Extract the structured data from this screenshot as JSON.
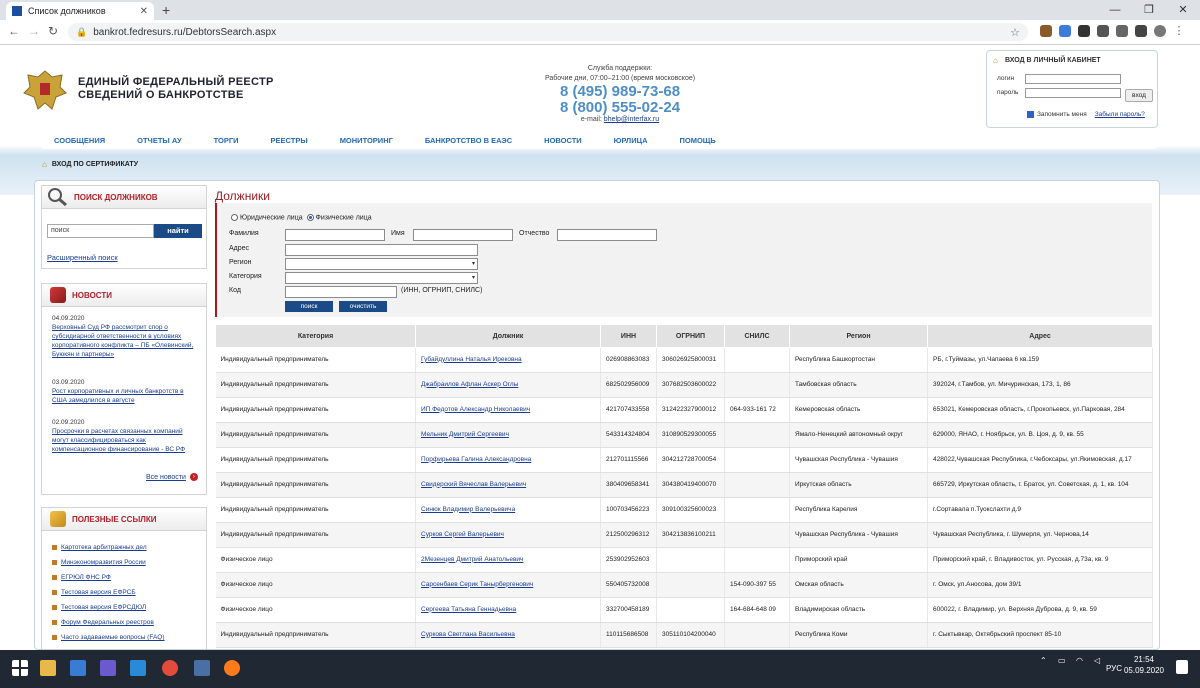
{
  "browser": {
    "tab_title": "Список должников",
    "new_tab": "+",
    "url": "bankrot.fedresurs.ru/DebtorsSearch.aspx",
    "window_controls": [
      "—",
      "❐",
      "✕"
    ]
  },
  "site": {
    "title_line1": "ЕДИНЫЙ ФЕДЕРАЛЬНЫЙ РЕЕСТР",
    "title_line2": "СВЕДЕНИЙ О БАНКРОТСТВЕ",
    "support_label": "Служба поддержки:",
    "support_hours": "Рабочие дни, 07:00–21:00 (время московское)",
    "phone1": "8 (495) 989-73-68",
    "phone2": "8 (800) 555-02-24",
    "email_label": "e-mail:",
    "email": "bhelp@interfax.ru"
  },
  "login": {
    "title": "ВХОД В ЛИЧНЫЙ КАБИНЕТ",
    "login_label": "логин",
    "password_label": "пароль",
    "button": "вход",
    "remember": "Запомнить меня",
    "forgot": "Забыли пароль?"
  },
  "menu": [
    "СООБЩЕНИЯ",
    "ОТЧЕТЫ АУ",
    "ТОРГИ",
    "РЕЕСТРЫ",
    "МОНИТОРИНГ",
    "БАНКРОТСТВО В ЕАЭС",
    "НОВОСТИ",
    "ЮРЛИЦА",
    "ПОМОЩЬ"
  ],
  "cert_login": "ВХОД ПО СЕРТИФИКАТУ",
  "sidebar": {
    "search_title": "ПОИСК ДОЛЖНИКОВ",
    "search_placeholder": "поиск",
    "search_button": "найти",
    "advanced": "Расширенный поиск",
    "news_title": "НОВОСТИ",
    "news": [
      {
        "date": "04.09.2020",
        "text": "Верховный Суд РФ рассмотрит спор о субсидиарной ответственности в условиях корпоративного конфликта – ПБ «Олевинский, Буюкян и партнеры»"
      },
      {
        "date": "03.09.2020",
        "text": "Рост корпоративных и личных банкротств в США замедлился в августе"
      },
      {
        "date": "02.09.2020",
        "text": "Просрочки в расчетах связанных компаний могут классифицироваться как компенсационное финансирование - ВС РФ"
      }
    ],
    "all_news": "Все новости",
    "links_title": "ПОЛЕЗНЫЕ ССЫЛКИ",
    "links": [
      "Картотека арбитражных дел",
      "Минэкономразвития России",
      "ЕГРЮЛ ФНС РФ",
      "Тестовая версия ЕФРСБ",
      "Тестовая версия ЕФРСДЮЛ",
      "Форум Федеральных реестров",
      "Часто задаваемые вопросы (FAQ)"
    ]
  },
  "content": {
    "title": "Должники",
    "radio_legal": "Юридические лица",
    "radio_person": "Физические лица",
    "surname": "Фамилия",
    "name": "Имя",
    "patronymic": "Отчество",
    "address": "Адрес",
    "region": "Регион",
    "category": "Категория",
    "code": "Код",
    "code_hint": "(ИНН, ОГРНИП, СНИЛС)",
    "search_btn": "поиск",
    "clear_btn": "очистить"
  },
  "table": {
    "headers": [
      "Категория",
      "Должник",
      "ИНН",
      "ОГРНИП",
      "СНИЛС",
      "Регион",
      "Адрес"
    ],
    "rows": [
      [
        "Индивидуальный предприниматель",
        "Губайдуллина Наталья Ирековна",
        "026908863083",
        "306026925800031",
        "",
        "Республика Башкортостан",
        "РБ, г.Туймазы, ул.Чапаева 6 кв.159"
      ],
      [
        "Индивидуальный предприниматель",
        "Джабраилов Афлан Аскер Оглы",
        "682502956009",
        "307682503600022",
        "",
        "Тамбовская область",
        "392024, г.Тамбов, ул. Мичуринская, 173, 1, 86"
      ],
      [
        "Индивидуальный предприниматель",
        "ИП Федотов Александр Николаевич",
        "421707433558",
        "312422327900012",
        "064-933-161 72",
        "Кемеровская область",
        "653021, Кемеровская область, г.Прокопьевск, ул.Парковая, 284"
      ],
      [
        "Индивидуальный предприниматель",
        "Мельник Дмитрий Сергеевич",
        "543314324804",
        "310890529300055",
        "",
        "Ямало-Ненецкий автономный округ",
        "629000, ЯНАО, г. Ноябрьск, ул. В. Цоя, д. 9, кв. 55"
      ],
      [
        "Индивидуальный предприниматель",
        "Порфирьева Галина Александровна",
        "212701115566",
        "304212728700054",
        "",
        "Чувашская Республика - Чувашия",
        "428022,Чувашская Республика, г.Чебоксары, ул.Якимовская, д.17"
      ],
      [
        "Индивидуальный предприниматель",
        "Свидерский Вячеслав Валерьевич",
        "380409658341",
        "304380419400070",
        "",
        "Иркутская область",
        "665729, Иркутская область, г. Братск, ул. Советская, д. 1, кв. 104"
      ],
      [
        "Индивидуальный предприниматель",
        "Синюк Владимир Валерьевича",
        "100703456223",
        "309100325600023",
        "",
        "Республика Карелия",
        "г.Сортавала п.Туокслахти д.9"
      ],
      [
        "Индивидуальный предприниматель",
        "Сурков Сергей Валерьевич",
        "212500296312",
        "304213836100211",
        "",
        "Чувашская Республика - Чувашия",
        "Чувашская Республика, г. Шумерля, ул. Чернова,14"
      ],
      [
        "Физическое лицо",
        "2Мезенцев Дмитрий Анатольевич",
        "253902952603",
        "",
        "",
        "Приморский край",
        "Приморский край, г. Владивосток, ул. Русская, д.73а, кв. 9"
      ],
      [
        "Физическое лицо",
        "Сарсенбаев Серик Танырбергенович",
        "550405732008",
        "",
        "154-090-397 55",
        "Омская область",
        "г. Омск, ул.Аносова, дом 39/1"
      ],
      [
        "Физическое лицо",
        "Сергеева Татьяна Геннадьевна",
        "332700458189",
        "",
        "164-684-648 09",
        "Владимирская область",
        "600022, г. Владимир, ул. Верхняя Дуброва, д. 9, кв. 59"
      ],
      [
        "Индивидуальный предприниматель",
        "Суркова Светлана Васильевна",
        "110115686508",
        "305110104200040",
        "",
        "Республика Коми",
        "г. Сыктывкар, Октябрьский проспект 85-10"
      ]
    ]
  },
  "taskbar": {
    "lang": "РУС",
    "time": "21:54",
    "date": "05.09.2020"
  },
  "colors": {
    "accent_red": "#9a1c25",
    "nav_blue": "#2469b0",
    "button_blue": "#1b4b86",
    "phone_blue": "#4d8ec5"
  }
}
